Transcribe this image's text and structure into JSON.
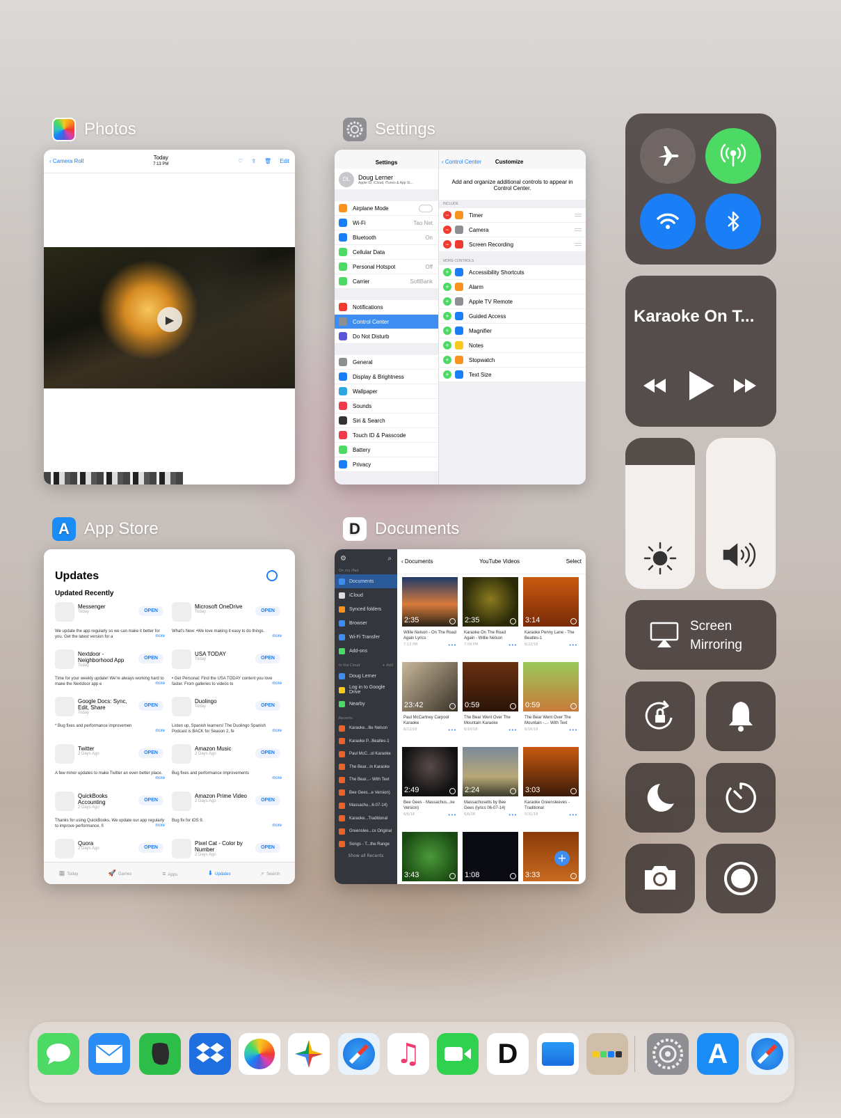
{
  "apps": {
    "photos": {
      "name": "Photos"
    },
    "settings": {
      "name": "Settings"
    },
    "appstore": {
      "name": "App Store"
    },
    "documents": {
      "name": "Documents"
    }
  },
  "photos_card": {
    "back": "Camera Roll",
    "date": "Today",
    "time": "7:13 PM",
    "edit": "Edit"
  },
  "settings_card": {
    "left_title": "Settings",
    "user_initials": "DL",
    "user_name": "Doug Lerner",
    "user_sub": "Apple ID, iCloud, iTunes & App St...",
    "group1": [
      {
        "label": "Airplane Mode",
        "value": "",
        "color": "#f7931e"
      },
      {
        "label": "Wi-Fi",
        "value": "Tao Net",
        "color": "#1a7ef7"
      },
      {
        "label": "Bluetooth",
        "value": "On",
        "color": "#1a7ef7"
      },
      {
        "label": "Cellular Data",
        "value": "",
        "color": "#4cd964"
      },
      {
        "label": "Personal Hotspot",
        "value": "Off",
        "color": "#4cd964"
      },
      {
        "label": "Carrier",
        "value": "SoftBank",
        "color": "#4cd964"
      }
    ],
    "group2": [
      {
        "label": "Notifications",
        "value": "",
        "color": "#f03b30"
      },
      {
        "label": "Control Center",
        "value": "",
        "color": "#8e8e93"
      },
      {
        "label": "Do Not Disturb",
        "value": "",
        "color": "#5856d6"
      }
    ],
    "group3": [
      {
        "label": "General",
        "value": "",
        "color": "#8e8e93"
      },
      {
        "label": "Display & Brightness",
        "value": "",
        "color": "#1a7ef7"
      },
      {
        "label": "Wallpaper",
        "value": "",
        "color": "#2ea7e0"
      },
      {
        "label": "Sounds",
        "value": "",
        "color": "#f03b4c"
      },
      {
        "label": "Siri & Search",
        "value": "",
        "color": "#333"
      },
      {
        "label": "Touch ID & Passcode",
        "value": "",
        "color": "#f03b4c"
      },
      {
        "label": "Battery",
        "value": "",
        "color": "#4cd964"
      },
      {
        "label": "Privacy",
        "value": "",
        "color": "#1a7ef7"
      }
    ],
    "right_back": "Control Center",
    "right_title": "Customize",
    "right_desc": "Add and organize additional controls to appear in Control Center.",
    "include_header": "INCLUDE",
    "include": [
      {
        "label": "Timer",
        "color": "#f7931e"
      },
      {
        "label": "Camera",
        "color": "#8e8e93"
      },
      {
        "label": "Screen Recording",
        "color": "#f03b30"
      }
    ],
    "more_header": "MORE CONTROLS",
    "more": [
      {
        "label": "Accessibility Shortcuts",
        "color": "#1a7ef7"
      },
      {
        "label": "Alarm",
        "color": "#f7931e"
      },
      {
        "label": "Apple TV Remote",
        "color": "#8e8e93"
      },
      {
        "label": "Guided Access",
        "color": "#1a7ef7"
      },
      {
        "label": "Magnifier",
        "color": "#1a7ef7"
      },
      {
        "label": "Notes",
        "color": "#f7c81e"
      },
      {
        "label": "Stopwatch",
        "color": "#f7931e"
      },
      {
        "label": "Text Size",
        "color": "#1a7ef7"
      }
    ]
  },
  "appstore_card": {
    "title": "Updates",
    "section": "Updated Recently",
    "open_label": "OPEN",
    "more_label": "more",
    "items": [
      {
        "name": "Messenger",
        "sub": "Today",
        "desc": "We update the app regularly so we can make it better for you. Get the latest version for a"
      },
      {
        "name": "Microsoft OneDrive",
        "sub": "Today",
        "desc": "What's New: •We love making it easy to do things."
      },
      {
        "name": "Nextdoor - Neighborhood App",
        "sub": "Today",
        "desc": "Time for your weekly update! We're always working hard to make the Nextdoor app e"
      },
      {
        "name": "USA TODAY",
        "sub": "Today",
        "desc": "• Get Personal: Find the USA TODAY content you love faster. From galleries to videos to"
      },
      {
        "name": "Google Docs: Sync, Edit, Share",
        "sub": "Today",
        "desc": "* Bug fixes and performance improvemen"
      },
      {
        "name": "Duolingo",
        "sub": "Today",
        "desc": "Listen up, Spanish learners! The Duolingo Spanish Podcast is BACK for Season 2, fe"
      },
      {
        "name": "Twitter",
        "sub": "2 Days Ago",
        "desc": "A few minor updates to make Twitter an even better place."
      },
      {
        "name": "Amazon Music",
        "sub": "2 Days Ago",
        "desc": "Bug fixes and performance improvements"
      },
      {
        "name": "QuickBooks Accounting",
        "sub": "2 Days Ago",
        "desc": "Thanks for using QuickBooks. We update our app regularly to improve performance, fi"
      },
      {
        "name": "Amazon Prime Video",
        "sub": "2 Days Ago",
        "desc": "Bug fix for iOS 9."
      },
      {
        "name": "Quora",
        "sub": "2 Days Ago",
        "desc": ""
      },
      {
        "name": "Pixel Cat - Color by Number",
        "sub": "2 Days Ago",
        "desc": ""
      }
    ],
    "tabs": [
      "Today",
      "Games",
      "Apps",
      "Updates",
      "Search"
    ]
  },
  "documents_card": {
    "on_my_ipad": "On my iPad",
    "sidebar": [
      {
        "label": "Documents",
        "color": "#3e8ef1"
      },
      {
        "label": "iCloud",
        "color": "#ddd"
      },
      {
        "label": "Synced folders",
        "color": "#f7931e"
      },
      {
        "label": "Browser",
        "color": "#3e8ef1"
      },
      {
        "label": "Wi-Fi Transfer",
        "color": "#3e8ef1"
      },
      {
        "label": "Add-ons",
        "color": "#4cd964"
      }
    ],
    "in_cloud": "In the Cloud",
    "add": "+ Add",
    "cloud": [
      {
        "label": "Doug Lerner",
        "color": "#3e8ef1"
      },
      {
        "label": "Log in to Google Drive",
        "color": "#f7c81e"
      },
      {
        "label": "Nearby",
        "color": "#4cd964"
      }
    ],
    "recents_header": "Recents",
    "recents": [
      "Karaoke...llie Nelson",
      "Karaoke P...Beatles-1",
      "Paul McC...ol Karaoke",
      "The Bear...in Karaoke",
      "The Bear...- With Text",
      "Bee Gees...e Version)",
      "Massachu...6-07-14)",
      "Karaoke...Traditional",
      "Greenslee...cx Original",
      "Songs - T...the Range"
    ],
    "show_all": "Show all Recents",
    "back": "Documents",
    "title": "YouTube Videos",
    "select": "Select",
    "videos": [
      {
        "dur": "2:35",
        "title": "Willie Nelson - On The Road Again Lyrics",
        "date": "7:13 PM",
        "bg": "linear-gradient(180deg,#1f3a6a,#d87a3a 55%,#2a2418)"
      },
      {
        "dur": "2:35",
        "title": "Karaoke On The Road Again - Willie Nelson",
        "date": "7:09 PM",
        "bg": "radial-gradient(circle at 50% 45%,#8a7a20,#2a2a08 70%)"
      },
      {
        "dur": "3:14",
        "title": "Karaoke Penny Lane - The Beatles-1",
        "date": "8/22/18",
        "bg": "linear-gradient(180deg,#c85a10,#7a2a08)"
      },
      {
        "dur": "23:42",
        "title": "Paul McCartney Carpool Karaoke",
        "date": "8/22/18",
        "bg": "linear-gradient(135deg,#c8b89a,#3a3228)"
      },
      {
        "dur": "0:59",
        "title": "The Bear Went Over The Mountain Karaoke",
        "date": "6/16/18",
        "bg": "linear-gradient(180deg,#6a3010,#2a1408)"
      },
      {
        "dur": "0:59",
        "title": "The Bear Went Over The Mountain -...- With Text",
        "date": "6/16/18",
        "bg": "linear-gradient(180deg,#9ac85a,#c87a3a)"
      },
      {
        "dur": "2:49",
        "title": "Bee Gees - Massachus...ke Version)",
        "date": "6/6/18",
        "bg": "radial-gradient(circle at 50% 40%,#5a4a4a,#111 70%)"
      },
      {
        "dur": "2:24",
        "title": "Massachusetts by Bee Gees (lyrics 06-07-14)",
        "date": "6/6/18",
        "bg": "linear-gradient(180deg,#7a8a9a,#b8a878 60%,#3a3a2a)"
      },
      {
        "dur": "3:03",
        "title": "Karaoke Greensleeves - Traditional",
        "date": "5/31/18",
        "bg": "linear-gradient(180deg,#c85a10,#3a1a08)"
      },
      {
        "dur": "3:43",
        "title": "",
        "date": "",
        "bg": "radial-gradient(circle,#4a9a3a,#1a4a12 80%)"
      },
      {
        "dur": "1:08",
        "title": "",
        "date": "",
        "bg": "#0a0a12"
      },
      {
        "dur": "3:33",
        "title": "",
        "date": "",
        "bg": "linear-gradient(180deg,#8a3a08,#c86a20)"
      }
    ]
  },
  "control_center": {
    "now_playing": "Karaoke On T...",
    "screen_mirroring": "Screen Mirroring",
    "colors": {
      "cellular": "#4cd964",
      "wifi": "#1a7ef7",
      "bluetooth": "#1a7ef7"
    },
    "brightness_level": 0.82,
    "volume_level": 1.0
  },
  "dock": {
    "apps": [
      {
        "icon": "messages-icon",
        "bg": "#4cd964"
      },
      {
        "icon": "mail-icon",
        "bg": "#2a8cf5"
      },
      {
        "icon": "evernote-icon",
        "bg": "#2dbe4a"
      },
      {
        "icon": "dropbox-icon",
        "bg": "#1f6fe0"
      },
      {
        "icon": "photos-icon",
        "bg": "#fff"
      },
      {
        "icon": "google-photos-icon",
        "bg": "#fff"
      },
      {
        "icon": "safari-icon",
        "bg": "#e8f2fb"
      },
      {
        "icon": "music-icon",
        "bg": "#fff"
      },
      {
        "icon": "facetime-icon",
        "bg": "#2fd14f"
      },
      {
        "icon": "documents-icon",
        "bg": "#fff"
      },
      {
        "icon": "files-icon",
        "bg": "#fff"
      },
      {
        "icon": "folder-icon",
        "bg": "#cfbfa8"
      },
      {
        "icon": "settings-icon",
        "bg": "#8e8e93"
      },
      {
        "icon": "app-store-icon",
        "bg": "#1a8cf5"
      },
      {
        "icon": "safari-recent-icon",
        "bg": "#e8f2fb"
      }
    ]
  }
}
